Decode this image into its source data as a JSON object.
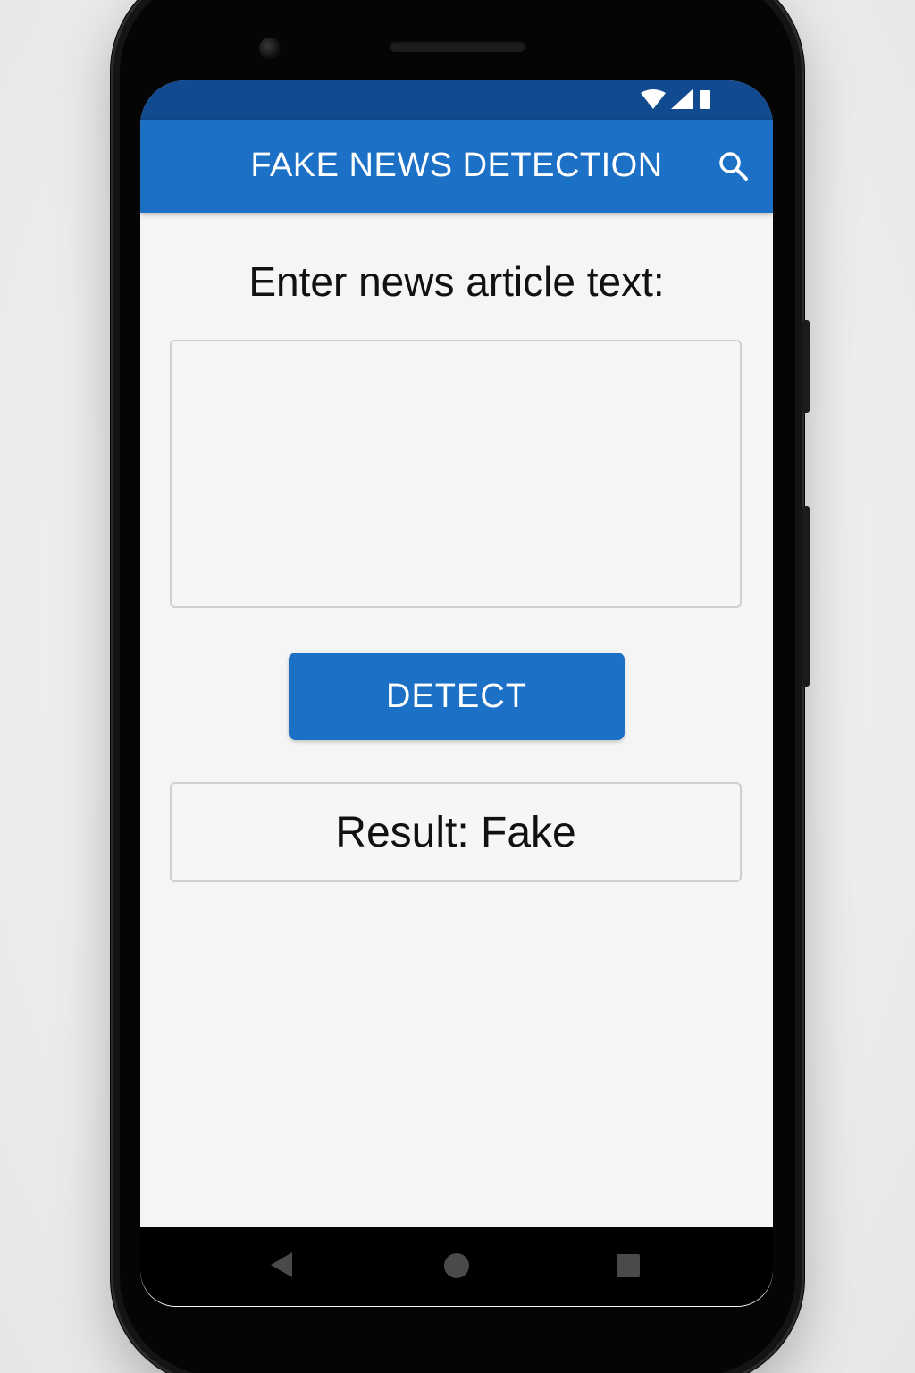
{
  "app_bar": {
    "title": "FAKE NEWS DETECTION",
    "action_icon": "search-icon",
    "color": "#1c70c6"
  },
  "status_bar": {
    "icons": [
      "wifi-icon",
      "signal-icon",
      "battery-icon"
    ],
    "color": "#124a8f"
  },
  "main": {
    "prompt": "Enter news article text:",
    "article_input": {
      "value": "",
      "placeholder": ""
    },
    "detect_button_label": "DETECT",
    "result_text": "Result: Fake"
  },
  "nav_bar": {
    "icons": [
      "back-icon",
      "home-icon",
      "recents-icon"
    ]
  }
}
